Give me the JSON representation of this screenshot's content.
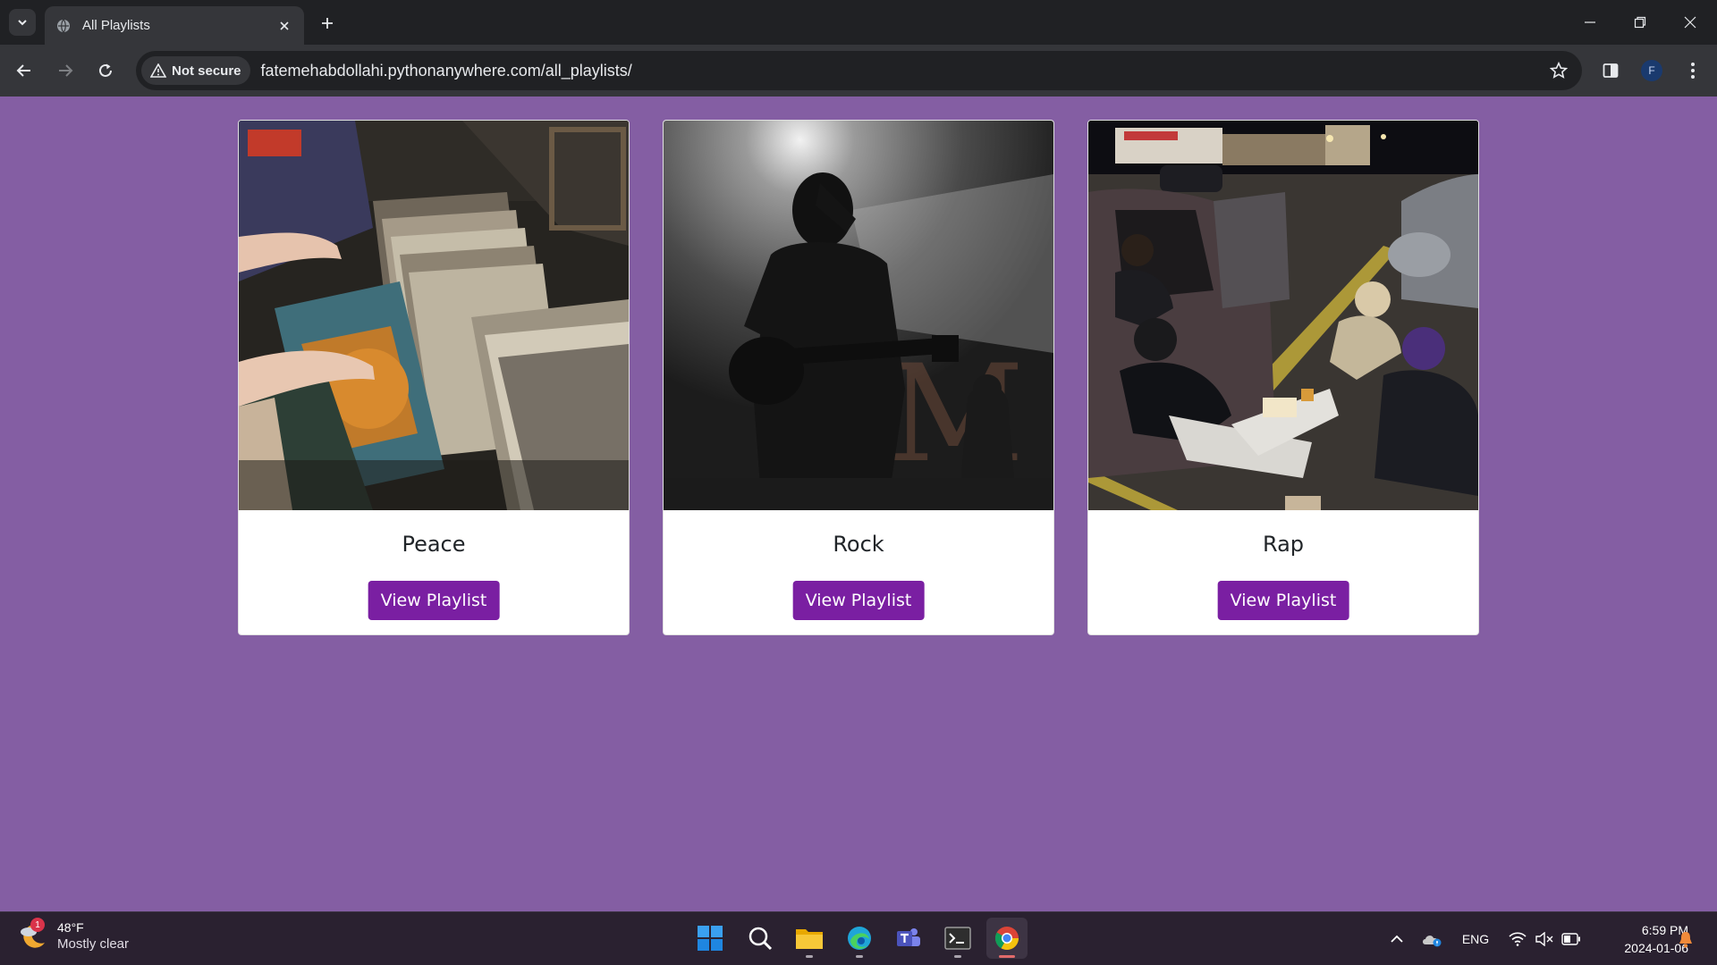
{
  "browser": {
    "tab_title": "All Playlists",
    "security_label": "Not secure",
    "url": "fatemehabdollahi.pythonanywhere.com/all_playlists/",
    "profile_initial": "F"
  },
  "cards": [
    {
      "title": "Peace",
      "button_label": "View Playlist",
      "image": "vinyl-records-photo"
    },
    {
      "title": "Rock",
      "button_label": "View Playlist",
      "image": "guitarist-silhouette-photo"
    },
    {
      "title": "Rap",
      "button_label": "View Playlist",
      "image": "friends-in-parking-lot-photo"
    }
  ],
  "taskbar": {
    "weather_temp": "48°F",
    "weather_condition": "Mostly clear",
    "weather_badge": "1",
    "language": "ENG",
    "time": "6:59 PM",
    "date": "2024-01-06",
    "apps": [
      "start-icon",
      "search-icon",
      "file-explorer-icon",
      "edge-icon",
      "teams-icon",
      "terminal-icon",
      "chrome-icon"
    ]
  },
  "colors": {
    "page_background": "#845ea3",
    "button": "#7a1fa2",
    "card": "#ffffff"
  }
}
